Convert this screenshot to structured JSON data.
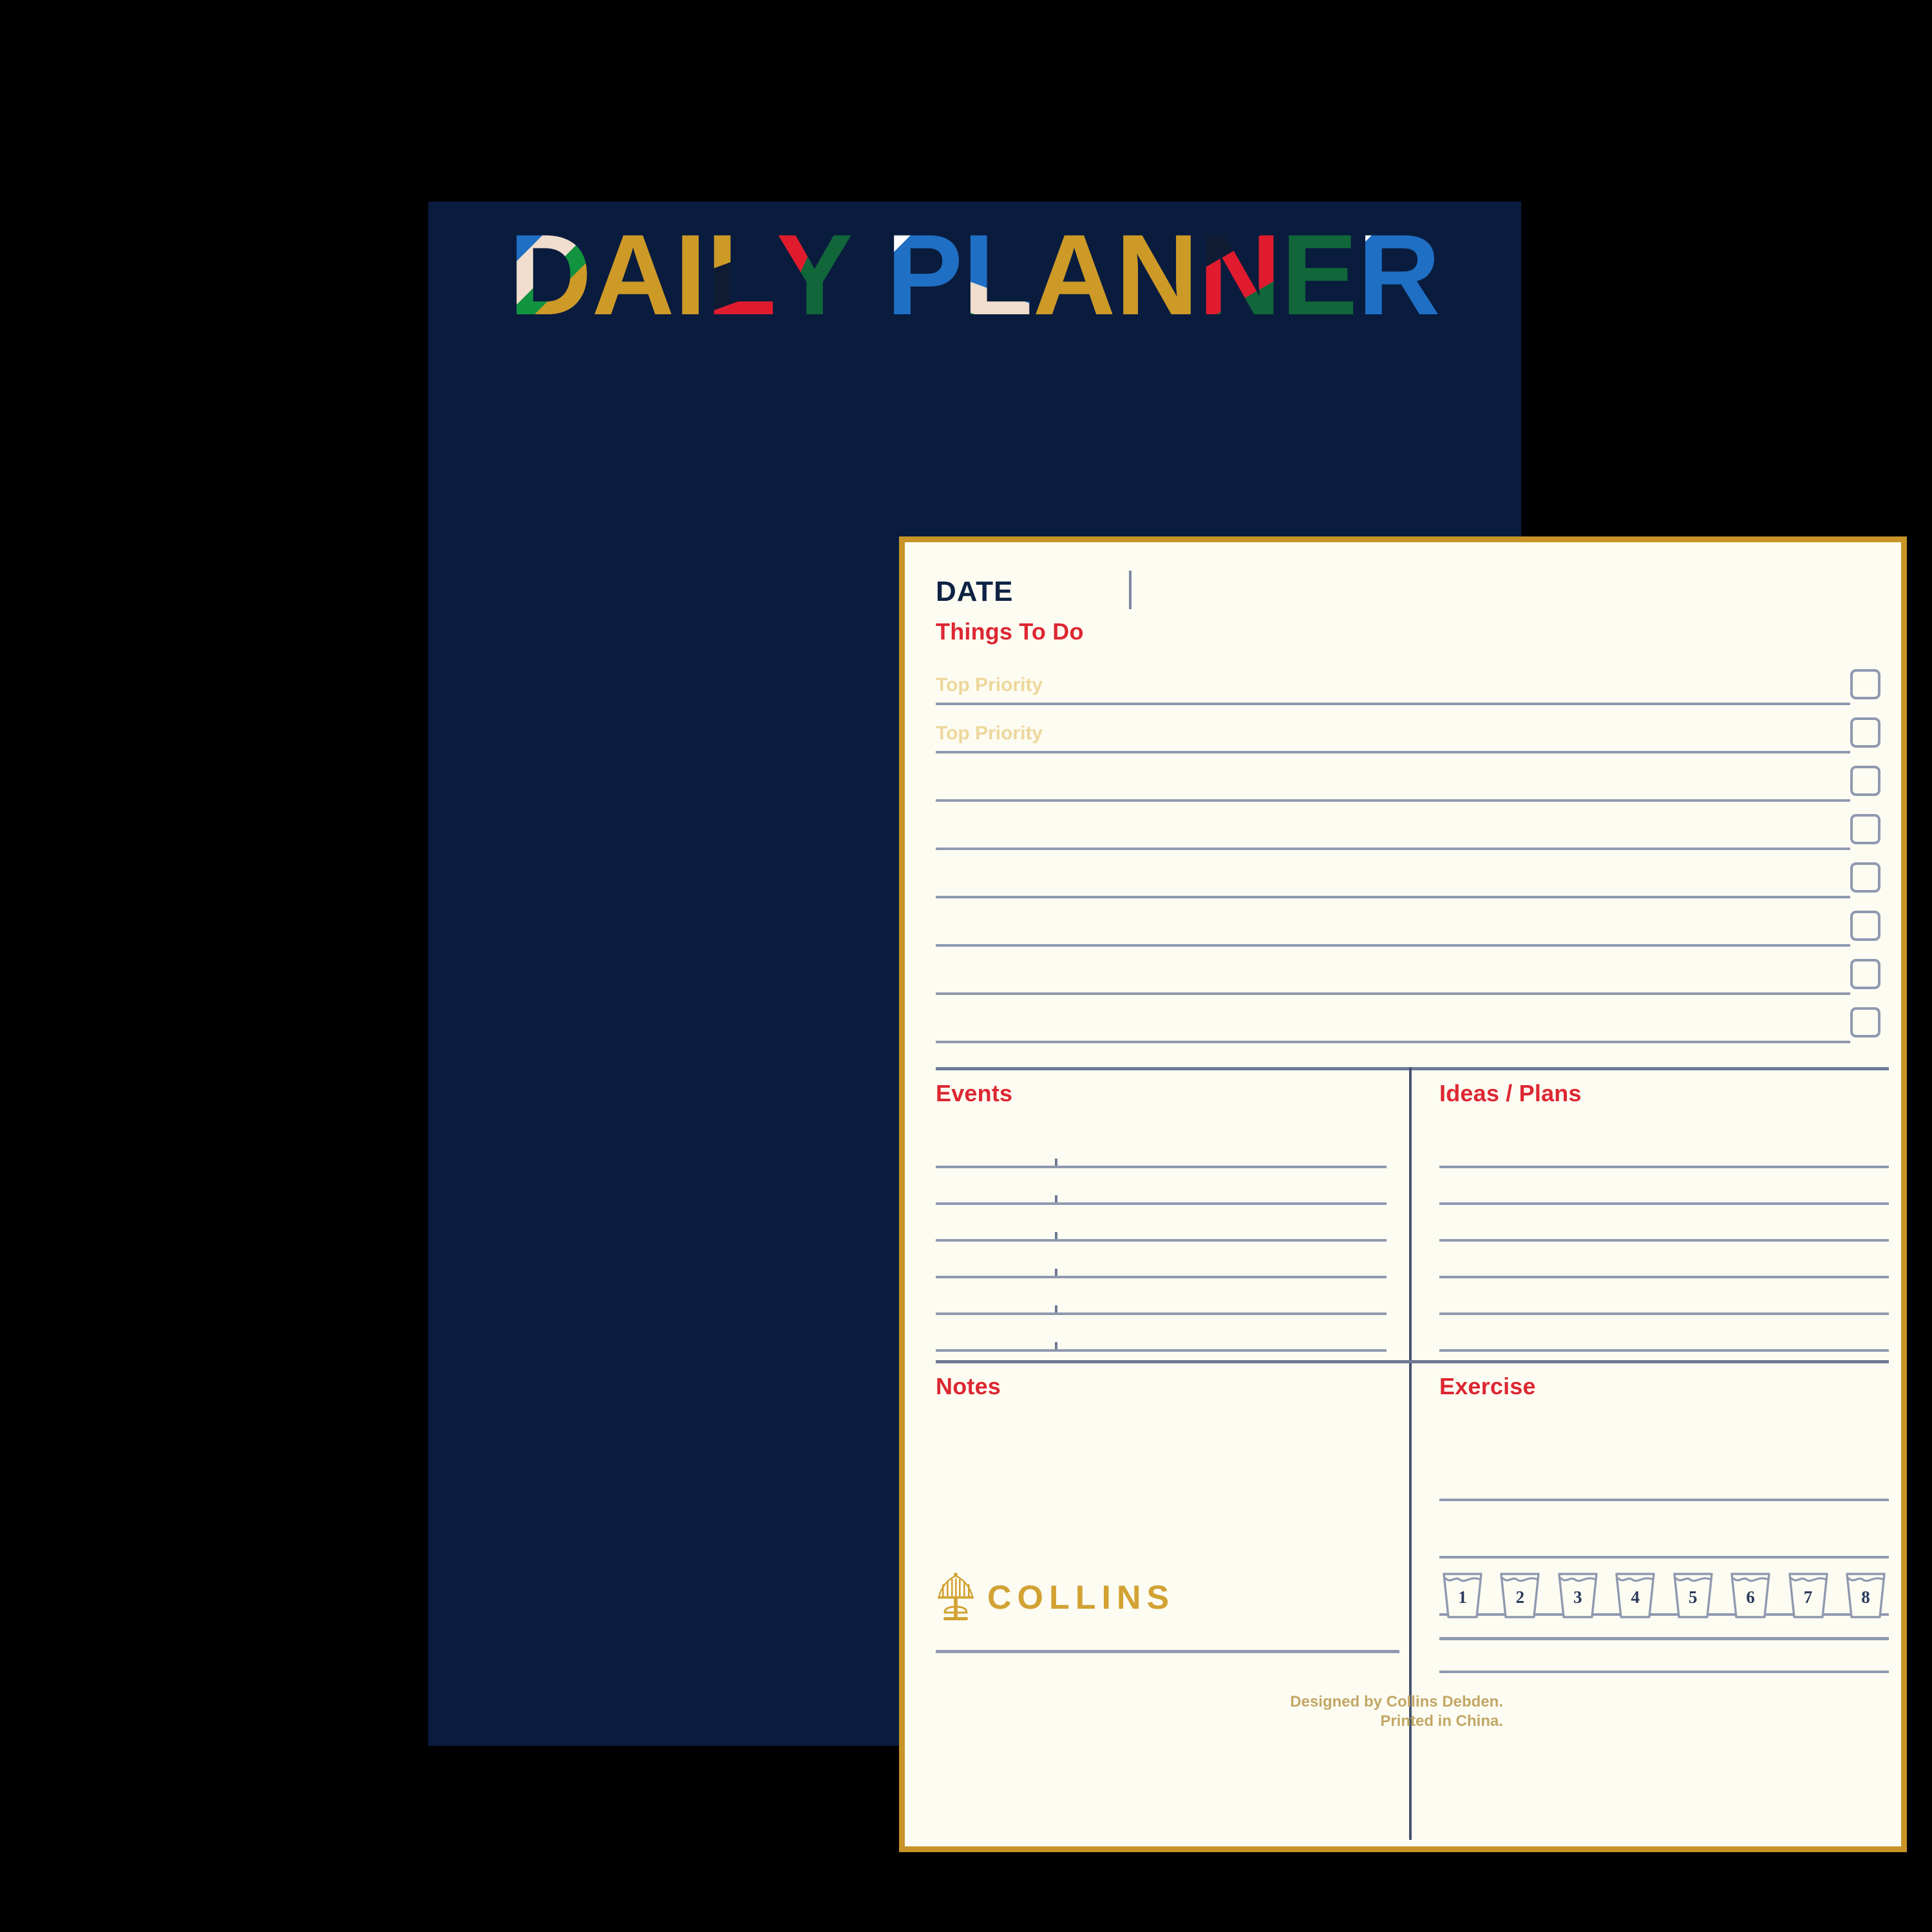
{
  "colors": {
    "navy": "#0a1c3e",
    "cream": "#fdfcf2",
    "gold_border": "#c89428",
    "red_heading": "#dd2732",
    "rule": "#8f99b0",
    "placeholder_gold": "#edd79b",
    "logo_gold": "#d2a233",
    "footer_gold": "#c2a766",
    "title_blue": "#1f6fc4",
    "title_green": "#12933f",
    "title_darkgreen": "#11663a",
    "title_red": "#e01b2e",
    "title_gold": "#cd9a27",
    "title_cream": "#f0ddcd",
    "title_white": "#ffffff",
    "title_dark": "#0e1b33"
  },
  "title": {
    "text": "DAILY PLANNER",
    "words": [
      {
        "word": "DAILY",
        "letters": [
          {
            "char": "D",
            "gradient": "linear-gradient(135deg,#1f6fc4 0%,#1f6fc4 26%,#f0ddcd 26%,#f0ddcd 48%,#12933f 48%,#12933f 62%,#cd9a27 62%,#cd9a27 100%)"
          },
          {
            "char": "A",
            "gradient": "linear-gradient(135deg,#cd9a27 0%,#cd9a27 100%)"
          },
          {
            "char": "I",
            "gradient": "linear-gradient(135deg,#cd9a27 0%,#cd9a27 100%)"
          },
          {
            "char": "L",
            "gradient": "linear-gradient(160deg,#cd9a27 0%,#cd9a27 38%,#0e1b33 38%,#0e1b33 68%,#e01b2e 68%,#e01b2e 100%)"
          },
          {
            "char": "Y",
            "gradient": "linear-gradient(115deg,#e01b2e 0%,#e01b2e 38%,#11663a 38%,#11663a 100%)"
          }
        ]
      },
      {
        "word": "PLANNER",
        "letters": [
          {
            "char": "P",
            "gradient": "linear-gradient(135deg,#12933f 0%,#12933f 10%,#ffffff 10%,#ffffff 22%,#1f6fc4 22%,#1f6fc4 100%)"
          },
          {
            "char": "L",
            "gradient": "linear-gradient(200deg,#1f6fc4 0%,#1f6fc4 62%,#f0ddcd 62%,#f0ddcd 84%,#12933f 84%,#12933f 100%)"
          },
          {
            "char": "A",
            "gradient": "linear-gradient(145deg,#f0ddcd 0%,#f0ddcd 7%,#12933f 7%,#12933f 20%,#cd9a27 20%,#cd9a27 100%)"
          },
          {
            "char": "N",
            "gradient": "linear-gradient(135deg,#cd9a27 0%,#cd9a27 100%)"
          },
          {
            "char": "N",
            "gradient": "linear-gradient(150deg,#cd9a27 0%,#cd9a27 13%,#0e1b33 13%,#0e1b33 33%,#e01b2e 33%,#e01b2e 66%,#11663a 66%,#11663a 100%)"
          },
          {
            "char": "E",
            "gradient": "linear-gradient(135deg,#11663a 0%,#11663a 100%)"
          },
          {
            "char": "R",
            "gradient": "linear-gradient(135deg,#ffffff 0%,#ffffff 16%,#1f6fc4 16%,#1f6fc4 100%)"
          }
        ]
      }
    ]
  },
  "date": {
    "label": "DATE",
    "value": "",
    "placeholder": ""
  },
  "things_to_do": {
    "heading": "Things To Do",
    "rows": [
      {
        "placeholder": "Top Priority",
        "value": "",
        "checked": false
      },
      {
        "placeholder": "Top Priority",
        "value": "",
        "checked": false
      },
      {
        "placeholder": "",
        "value": "",
        "checked": false
      },
      {
        "placeholder": "",
        "value": "",
        "checked": false
      },
      {
        "placeholder": "",
        "value": "",
        "checked": false
      },
      {
        "placeholder": "",
        "value": "",
        "checked": false
      },
      {
        "placeholder": "",
        "value": "",
        "checked": false
      },
      {
        "placeholder": "",
        "value": "",
        "checked": false
      }
    ]
  },
  "events": {
    "heading": "Events",
    "lines": [
      "",
      "",
      "",
      "",
      "",
      ""
    ],
    "has_time_ticks": true
  },
  "ideas_plans": {
    "heading": "Ideas / Plans",
    "lines": [
      "",
      "",
      "",
      "",
      "",
      ""
    ]
  },
  "notes": {
    "heading": "Notes",
    "lines": []
  },
  "exercise": {
    "heading": "Exercise",
    "lines": [
      "",
      "",
      "",
      ""
    ]
  },
  "water_tracker": {
    "glasses": [
      "1",
      "2",
      "3",
      "4",
      "5",
      "6",
      "7",
      "8"
    ]
  },
  "brand": {
    "name": "COLLINS",
    "icon": "collins-tree-logo"
  },
  "footer": {
    "line1": "Designed by Collins Debden.",
    "line2": "Printed in China."
  }
}
